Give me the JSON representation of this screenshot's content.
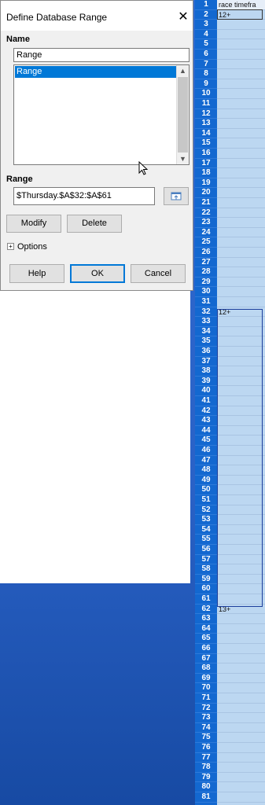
{
  "dialog": {
    "title": "Define Database Range",
    "close_glyph": "✕",
    "name_label": "Name",
    "name_value": "Range",
    "list_items": [
      "Range"
    ],
    "range_label": "Range",
    "range_value": "$Thursday.$A$32:$A$61",
    "modify_label": "Modify",
    "delete_label": "Delete",
    "options_label": "Options",
    "options_toggle": "+",
    "help_label": "Help",
    "ok_label": "OK",
    "cancel_label": "Cancel",
    "shrink_icon": "shrink-dialog-icon"
  },
  "sheet": {
    "header_text": "race timefra",
    "rows_start": 1,
    "rows_end": 81,
    "cell_values": {
      "2": "12+",
      "32": "12+",
      "62": "13+"
    }
  },
  "colors": {
    "row_header": "#1368d0",
    "cells": "#bcd7f1",
    "selection": "#0078d7"
  }
}
